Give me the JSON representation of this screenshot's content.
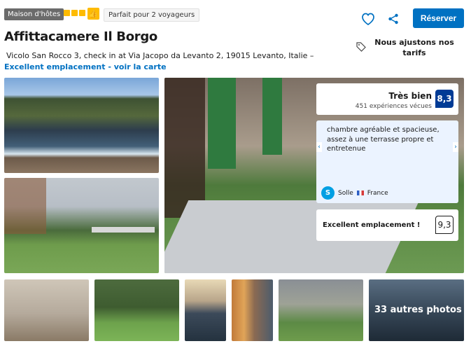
{
  "header": {
    "type_badge": "Maison d'hôtes",
    "stars": 3,
    "capacity": "Parfait pour 2 voyageurs",
    "title": "Affittacamere Il Borgo",
    "address": "Vicolo San Rocco 3, check in at Via Jacopo da Levanto 2, 19015 Levanto, Italie –",
    "map_link": "Excellent emplacement - voir la carte"
  },
  "actions": {
    "reserve_label": "Réserver",
    "price_note": "Nous ajustons nos tarifs"
  },
  "icons": [
    "map-pin-icon",
    "heart-icon",
    "share-icon",
    "price-tag-icon",
    "thumbs-up-icon",
    "star-icon"
  ],
  "colors": {
    "brand": "#0071c2",
    "score": "#003b95",
    "star": "#febb02"
  },
  "review": {
    "label": "Très bien",
    "count": "451 expériences vécues",
    "score": "8,3",
    "quote": "chambre agréable et spacieuse, assez à une terrasse propre et entretenue",
    "reviewer_initial": "S",
    "reviewer_name": "Solle",
    "reviewer_country": "France",
    "location_label": "Excellent emplacement !",
    "location_score": "9,3"
  },
  "gallery": {
    "more_photos": "33 autres photos"
  }
}
